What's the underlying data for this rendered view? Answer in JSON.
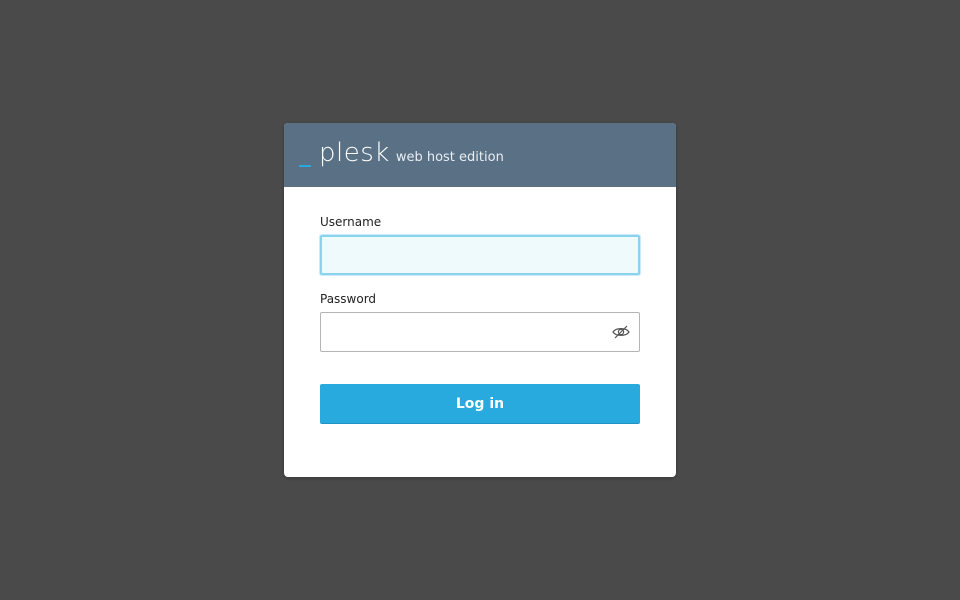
{
  "header": {
    "logo_text": "plesk",
    "edition_text": "web host edition"
  },
  "form": {
    "username_label": "Username",
    "username_value": "",
    "password_label": "Password",
    "password_value": "",
    "login_label": "Log in"
  },
  "icons": {
    "password_toggle": "eye-slash-icon"
  },
  "colors": {
    "background": "#4a4a4a",
    "header": "#5a7085",
    "accent": "#28aade",
    "focus_border": "#89d3ee"
  }
}
